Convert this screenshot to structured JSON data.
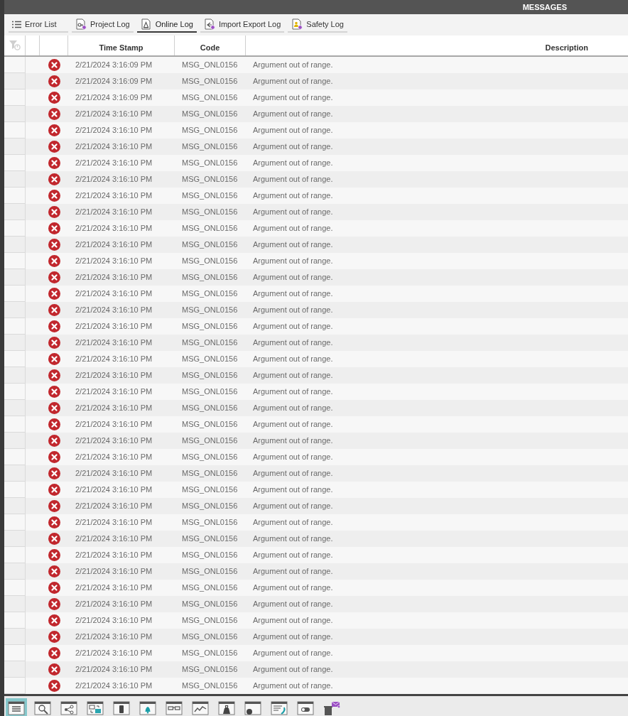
{
  "window": {
    "title": "MESSAGES"
  },
  "tabs": [
    {
      "label": "Error List",
      "selected": false
    },
    {
      "label": "Project Log",
      "selected": false
    },
    {
      "label": "Online Log",
      "selected": true
    },
    {
      "label": "Import Export Log",
      "selected": false
    },
    {
      "label": "Safety Log",
      "selected": false
    }
  ],
  "table": {
    "filter_button": {
      "disabled": true
    },
    "columns": [
      {
        "label": "Time Stamp"
      },
      {
        "label": "Code"
      },
      {
        "label": "Description"
      }
    ],
    "rows": [
      {
        "kind": "error",
        "time_stamp": "2/21/2024 3:16:09 PM",
        "code": "MSG_ONL0156",
        "description": "Argument out of range."
      },
      {
        "kind": "error",
        "time_stamp": "2/21/2024 3:16:09 PM",
        "code": "MSG_ONL0156",
        "description": "Argument out of range."
      },
      {
        "kind": "error",
        "time_stamp": "2/21/2024 3:16:09 PM",
        "code": "MSG_ONL0156",
        "description": "Argument out of range."
      },
      {
        "kind": "error",
        "time_stamp": "2/21/2024 3:16:10 PM",
        "code": "MSG_ONL0156",
        "description": "Argument out of range."
      },
      {
        "kind": "error",
        "time_stamp": "2/21/2024 3:16:10 PM",
        "code": "MSG_ONL0156",
        "description": "Argument out of range."
      },
      {
        "kind": "error",
        "time_stamp": "2/21/2024 3:16:10 PM",
        "code": "MSG_ONL0156",
        "description": "Argument out of range."
      },
      {
        "kind": "error",
        "time_stamp": "2/21/2024 3:16:10 PM",
        "code": "MSG_ONL0156",
        "description": "Argument out of range."
      },
      {
        "kind": "error",
        "time_stamp": "2/21/2024 3:16:10 PM",
        "code": "MSG_ONL0156",
        "description": "Argument out of range."
      },
      {
        "kind": "error",
        "time_stamp": "2/21/2024 3:16:10 PM",
        "code": "MSG_ONL0156",
        "description": "Argument out of range."
      },
      {
        "kind": "error",
        "time_stamp": "2/21/2024 3:16:10 PM",
        "code": "MSG_ONL0156",
        "description": "Argument out of range."
      },
      {
        "kind": "error",
        "time_stamp": "2/21/2024 3:16:10 PM",
        "code": "MSG_ONL0156",
        "description": "Argument out of range."
      },
      {
        "kind": "error",
        "time_stamp": "2/21/2024 3:16:10 PM",
        "code": "MSG_ONL0156",
        "description": "Argument out of range."
      },
      {
        "kind": "error",
        "time_stamp": "2/21/2024 3:16:10 PM",
        "code": "MSG_ONL0156",
        "description": "Argument out of range."
      },
      {
        "kind": "error",
        "time_stamp": "2/21/2024 3:16:10 PM",
        "code": "MSG_ONL0156",
        "description": "Argument out of range."
      },
      {
        "kind": "error",
        "time_stamp": "2/21/2024 3:16:10 PM",
        "code": "MSG_ONL0156",
        "description": "Argument out of range."
      },
      {
        "kind": "error",
        "time_stamp": "2/21/2024 3:16:10 PM",
        "code": "MSG_ONL0156",
        "description": "Argument out of range."
      },
      {
        "kind": "error",
        "time_stamp": "2/21/2024 3:16:10 PM",
        "code": "MSG_ONL0156",
        "description": "Argument out of range."
      },
      {
        "kind": "error",
        "time_stamp": "2/21/2024 3:16:10 PM",
        "code": "MSG_ONL0156",
        "description": "Argument out of range."
      },
      {
        "kind": "error",
        "time_stamp": "2/21/2024 3:16:10 PM",
        "code": "MSG_ONL0156",
        "description": "Argument out of range."
      },
      {
        "kind": "error",
        "time_stamp": "2/21/2024 3:16:10 PM",
        "code": "MSG_ONL0156",
        "description": "Argument out of range."
      },
      {
        "kind": "error",
        "time_stamp": "2/21/2024 3:16:10 PM",
        "code": "MSG_ONL0156",
        "description": "Argument out of range."
      },
      {
        "kind": "error",
        "time_stamp": "2/21/2024 3:16:10 PM",
        "code": "MSG_ONL0156",
        "description": "Argument out of range."
      },
      {
        "kind": "error",
        "time_stamp": "2/21/2024 3:16:10 PM",
        "code": "MSG_ONL0156",
        "description": "Argument out of range."
      },
      {
        "kind": "error",
        "time_stamp": "2/21/2024 3:16:10 PM",
        "code": "MSG_ONL0156",
        "description": "Argument out of range."
      },
      {
        "kind": "error",
        "time_stamp": "2/21/2024 3:16:10 PM",
        "code": "MSG_ONL0156",
        "description": "Argument out of range."
      },
      {
        "kind": "error",
        "time_stamp": "2/21/2024 3:16:10 PM",
        "code": "MSG_ONL0156",
        "description": "Argument out of range."
      },
      {
        "kind": "error",
        "time_stamp": "2/21/2024 3:16:10 PM",
        "code": "MSG_ONL0156",
        "description": "Argument out of range."
      },
      {
        "kind": "error",
        "time_stamp": "2/21/2024 3:16:10 PM",
        "code": "MSG_ONL0156",
        "description": "Argument out of range."
      },
      {
        "kind": "error",
        "time_stamp": "2/21/2024 3:16:10 PM",
        "code": "MSG_ONL0156",
        "description": "Argument out of range."
      },
      {
        "kind": "error",
        "time_stamp": "2/21/2024 3:16:10 PM",
        "code": "MSG_ONL0156",
        "description": "Argument out of range."
      },
      {
        "kind": "error",
        "time_stamp": "2/21/2024 3:16:10 PM",
        "code": "MSG_ONL0156",
        "description": "Argument out of range."
      },
      {
        "kind": "error",
        "time_stamp": "2/21/2024 3:16:10 PM",
        "code": "MSG_ONL0156",
        "description": "Argument out of range."
      },
      {
        "kind": "error",
        "time_stamp": "2/21/2024 3:16:10 PM",
        "code": "MSG_ONL0156",
        "description": "Argument out of range."
      },
      {
        "kind": "error",
        "time_stamp": "2/21/2024 3:16:10 PM",
        "code": "MSG_ONL0156",
        "description": "Argument out of range."
      },
      {
        "kind": "error",
        "time_stamp": "2/21/2024 3:16:10 PM",
        "code": "MSG_ONL0156",
        "description": "Argument out of range."
      },
      {
        "kind": "error",
        "time_stamp": "2/21/2024 3:16:10 PM",
        "code": "MSG_ONL0156",
        "description": "Argument out of range."
      },
      {
        "kind": "error",
        "time_stamp": "2/21/2024 3:16:10 PM",
        "code": "MSG_ONL0156",
        "description": "Argument out of range."
      },
      {
        "kind": "error",
        "time_stamp": "2/21/2024 3:16:10 PM",
        "code": "MSG_ONL0156",
        "description": "Argument out of range."
      },
      {
        "kind": "error",
        "time_stamp": "2/21/2024 3:16:10 PM",
        "code": "MSG_ONL0156",
        "description": "Argument out of range."
      }
    ]
  },
  "toolbar": {
    "items": [
      {
        "selected": true
      },
      {
        "selected": false
      },
      {
        "selected": false
      },
      {
        "selected": false
      },
      {
        "selected": false
      },
      {
        "selected": false
      },
      {
        "selected": false
      },
      {
        "selected": false
      },
      {
        "selected": false
      },
      {
        "selected": false
      },
      {
        "selected": false
      },
      {
        "selected": false
      },
      {
        "selected": false
      }
    ]
  }
}
